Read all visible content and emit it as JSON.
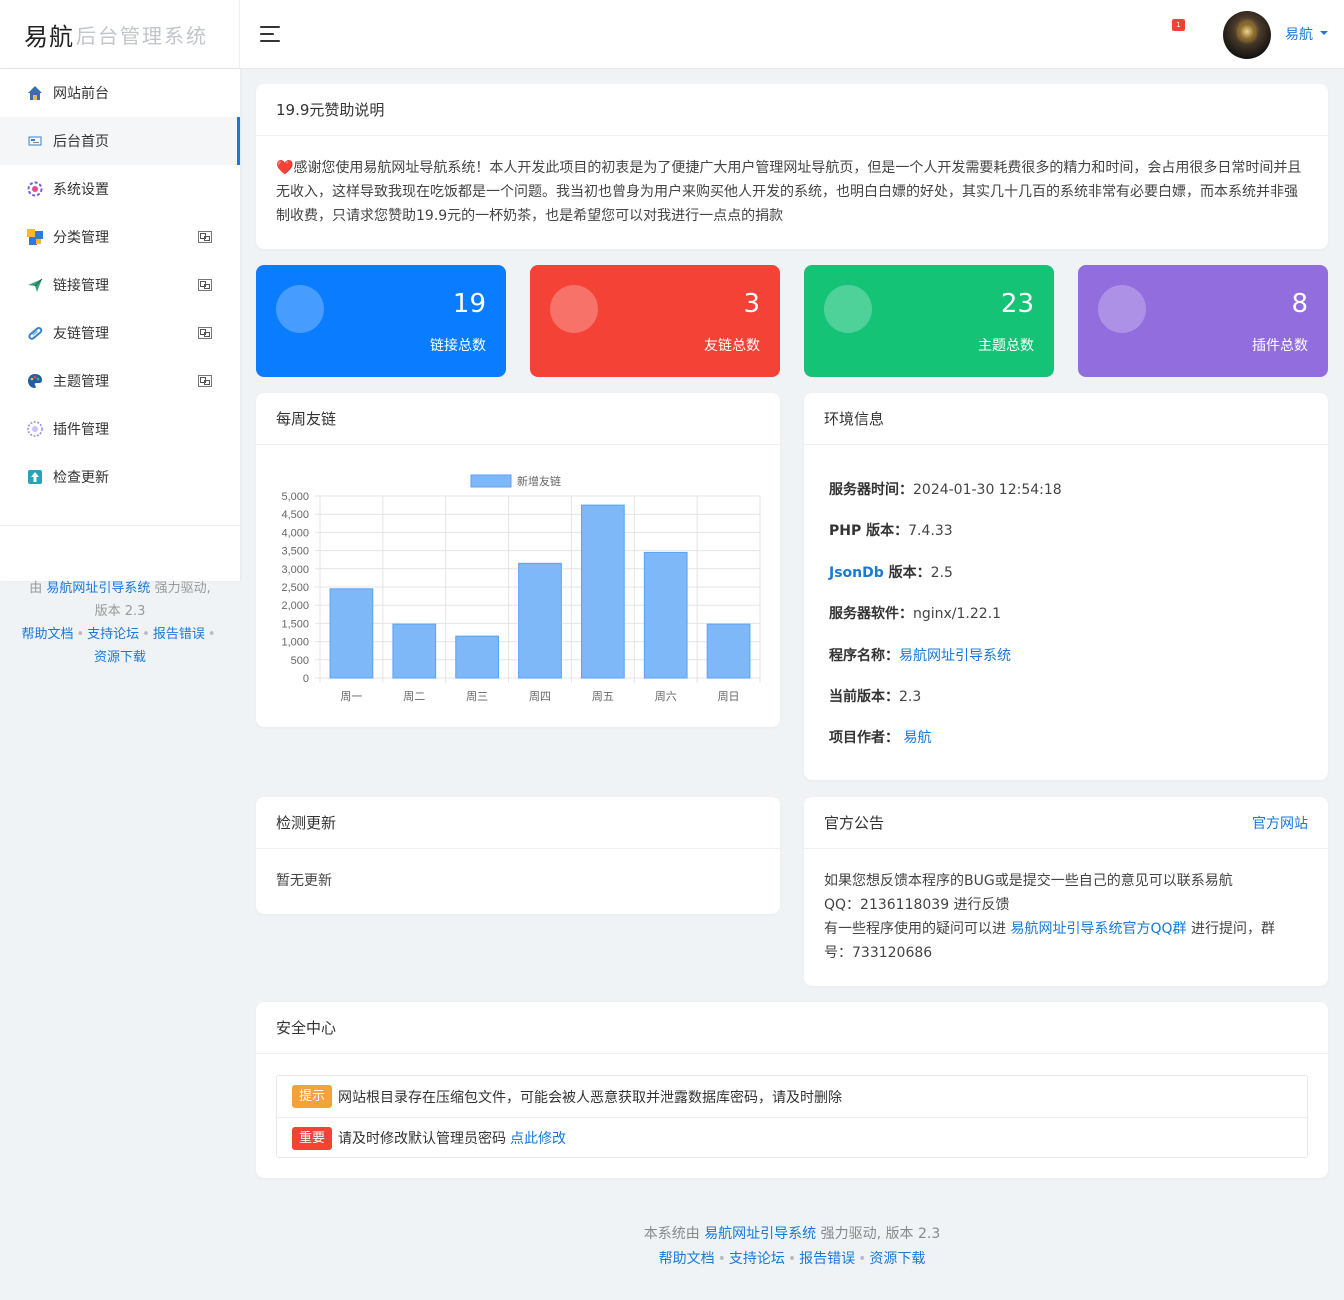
{
  "brand": {
    "logo": "易航",
    "subtitle": "后台管理系统"
  },
  "header": {
    "notify_count": "1",
    "user_name": "易航"
  },
  "sidebar": {
    "items": [
      {
        "label": "网站前台",
        "icon": "home-icon"
      },
      {
        "label": "后台首页",
        "icon": "dashboard-icon"
      },
      {
        "label": "系统设置",
        "icon": "settings-icon"
      },
      {
        "label": "分类管理",
        "icon": "category-icon"
      },
      {
        "label": "链接管理",
        "icon": "send-icon"
      },
      {
        "label": "友链管理",
        "icon": "link-icon"
      },
      {
        "label": "主题管理",
        "icon": "palette-icon"
      },
      {
        "label": "插件管理",
        "icon": "plugin-icon"
      },
      {
        "label": "检查更新",
        "icon": "update-icon"
      }
    ],
    "footer": {
      "by": "由",
      "system": "易航网址引导系统",
      "powered": "强力驱动,",
      "version": "版本 2.3",
      "links": [
        "帮助文档",
        "支持论坛",
        "报告错误",
        "资源下载"
      ]
    }
  },
  "sponsor": {
    "title": "19.9元赞助说明",
    "heart": "❤️",
    "text": "感谢您使用易航网址导航系统！本人开发此项目的初衷是为了便捷广大用户管理网址导航页，但是一个人开发需要耗费很多的精力和时间，会占用很多日常时间并且无收入，这样导致我现在吃饭都是一个问题。我当初也曾身为用户来购买他人开发的系统，也明白白嫖的好处，其实几十几百的系统非常有必要白嫖，而本系统并非强制收费，只请求您赞助19.9元的一杯奶茶，也是希望您可以对我进行一点点的捐款"
  },
  "stats": [
    {
      "value": "19",
      "label": "链接总数",
      "color": "#0a7cff"
    },
    {
      "value": "3",
      "label": "友链总数",
      "color": "#f44336"
    },
    {
      "value": "23",
      "label": "主题总数",
      "color": "#15c377"
    },
    {
      "value": "8",
      "label": "插件总数",
      "color": "#926dde"
    }
  ],
  "weekly": {
    "title": "每周友链",
    "chart_data": {
      "type": "bar",
      "categories": [
        "周一",
        "周二",
        "周三",
        "周四",
        "周五",
        "周六",
        "周日"
      ],
      "series": [
        {
          "name": "新增友链",
          "values": [
            2450,
            1480,
            1150,
            3150,
            4750,
            3450,
            1480
          ]
        }
      ],
      "ylim": [
        0,
        5000
      ],
      "yticks": [
        "0",
        "500",
        "1,000",
        "1,500",
        "2,000",
        "2,500",
        "3,000",
        "3,500",
        "4,000",
        "4,500",
        "5,000"
      ],
      "grid": true,
      "legend": "top",
      "color": "#7fb8f9"
    }
  },
  "env": {
    "title": "环境信息",
    "server_time_label": "服务器时间：",
    "server_time": "2024-01-30 12:54:18",
    "php_label": "PHP 版本：",
    "php": "7.4.33",
    "jsondb_name": "JsonDb",
    "jsondb_label": " 版本：",
    "jsondb": "2.5",
    "software_label": "服务器软件：",
    "software": "nginx/1.22.1",
    "program_label": "程序名称：",
    "program": "易航网址引导系统",
    "version_label": "当前版本：",
    "version": "2.3",
    "author_label": "项目作者：",
    "author": "易航"
  },
  "update": {
    "title": "检测更新",
    "text": "暂无更新"
  },
  "notice": {
    "title": "官方公告",
    "link": "官方网站",
    "line1": "如果您想反馈本程序的BUG或是提交一些自己的意见可以联系易航",
    "line2": "QQ：2136118039 进行反馈",
    "line3a": "有一些程序使用的疑问可以进 ",
    "line3link": "易航网址引导系统官方QQ群",
    "line3b": " 进行提问，群",
    "line4": "号：733120686"
  },
  "security": {
    "title": "安全中心",
    "rows": [
      {
        "tag": "提示",
        "tag_color": "#f5a23a",
        "text": "网站根目录存在压缩包文件，可能会被人恶意获取并泄露数据库密码，请及时删除",
        "link": ""
      },
      {
        "tag": "重要",
        "tag_color": "#f44336",
        "text": "请及时修改默认管理员密码 ",
        "link": "点此修改"
      }
    ]
  },
  "footer": {
    "prefix": "本系统由",
    "system": "易航网址引导系统",
    "suffix": "强力驱动, 版本 2.3",
    "links": [
      "帮助文档",
      "支持论坛",
      "报告错误",
      "资源下载"
    ]
  }
}
